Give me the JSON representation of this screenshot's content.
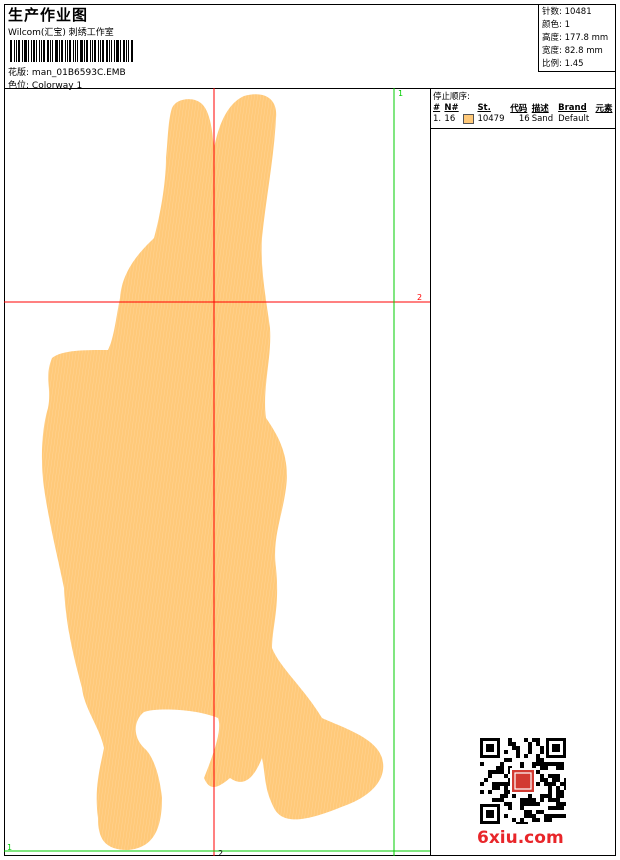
{
  "header": {
    "title": "生产作业图",
    "company": "Wilcom(汇宝) 刺绣工作室",
    "design_label": "花版:",
    "design_value": "man_01B6593C.EMB",
    "colorway_label": "色位:",
    "colorway_value": "Colorway 1"
  },
  "stats": {
    "stitches_label": "针数:",
    "stitches_value": "10481",
    "colors_label": "颜色:",
    "colors_value": "1",
    "height_label": "高度:",
    "height_value": "177.8 mm",
    "width_label": "宽度:",
    "width_value": "82.8 mm",
    "scale_label": "比例:",
    "scale_value": "1.45"
  },
  "stop_sequence": {
    "title": "停止顺序:",
    "columns": [
      "#",
      "N#",
      "St.",
      "代码",
      "描述",
      "Brand",
      "元素"
    ],
    "rows": [
      {
        "num": "1.",
        "n": "16",
        "swatch_color": "#FFC979",
        "st": "10479",
        "code": "16",
        "desc": "Sand",
        "brand": "Default",
        "element": ""
      }
    ]
  },
  "canvas": {
    "fill_color": "#FFC979",
    "guide_red": "#FF0000",
    "guide_green": "#00CC00",
    "labels": {
      "g1_top": "1",
      "g1_bottom": "1",
      "r2_right": "2",
      "r2_bottom": "2"
    }
  },
  "watermark": {
    "brand": "6xiu.com"
  }
}
